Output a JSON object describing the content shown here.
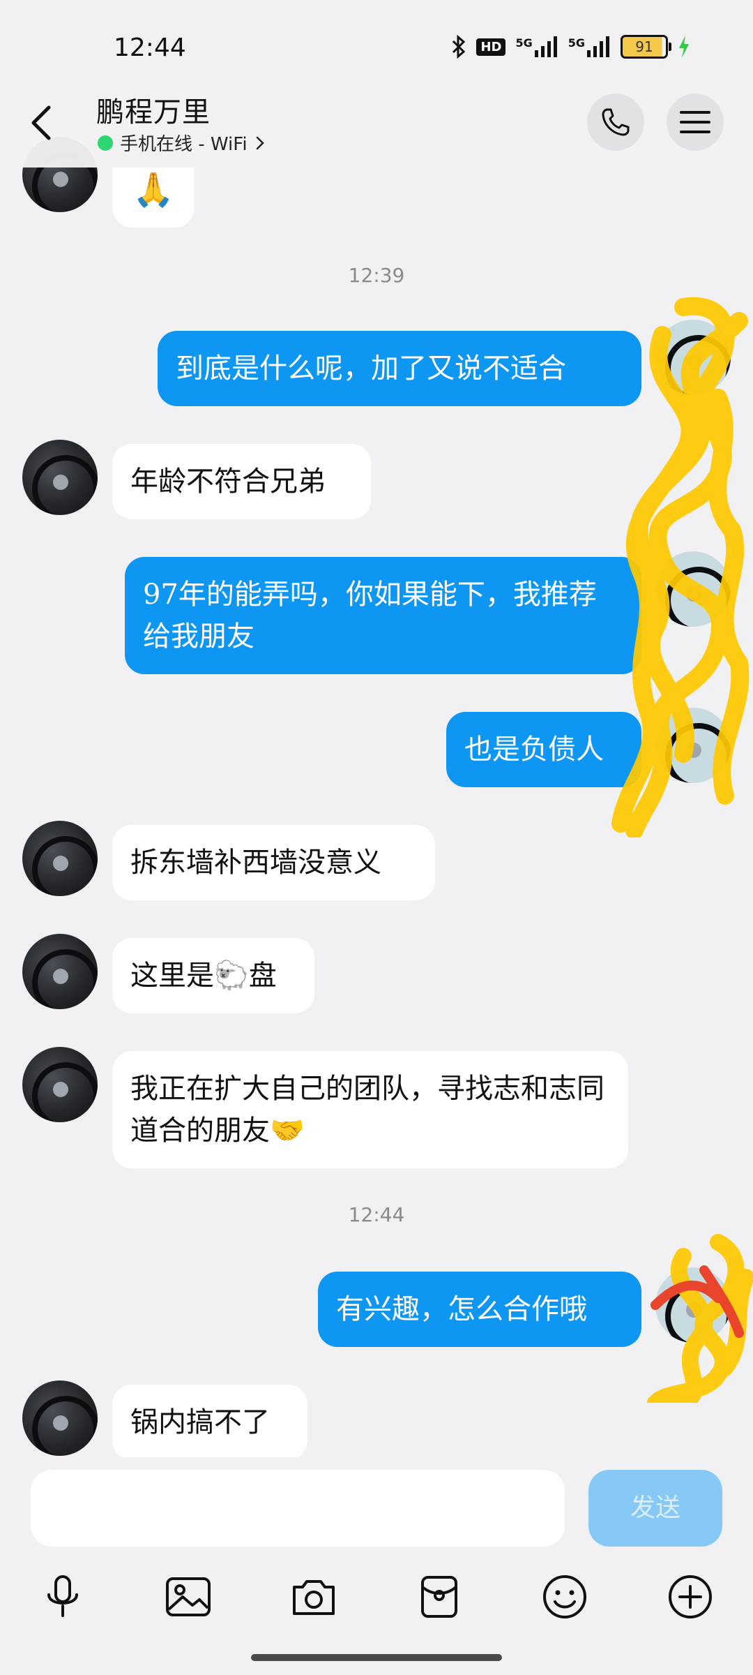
{
  "status_bar": {
    "time": "12:44",
    "hd_label": "HD",
    "signal1_label": "5G",
    "signal2_label": "5G",
    "battery": "91"
  },
  "header": {
    "contact_name": "鹏程万里",
    "status_text": "手机在线 - WiFi",
    "status_color": "#2ed573"
  },
  "messages": [
    {
      "side": "in",
      "text": "🙏"
    },
    {
      "timestamp": "12:39"
    },
    {
      "side": "out",
      "text": "到底是什么呢，加了又说不适合"
    },
    {
      "side": "in",
      "text": "年龄不符合兄弟"
    },
    {
      "side": "out",
      "text": "97年的能弄吗，你如果能下，我推荐给我朋友"
    },
    {
      "side": "out",
      "text": "也是负债人"
    },
    {
      "side": "in",
      "text": "拆东墙补西墙没意义"
    },
    {
      "side": "in",
      "text": "这里是🐑盘"
    },
    {
      "side": "in",
      "text": "我正在扩大自己的团队，寻找志和志同道合的朋友🤝"
    },
    {
      "timestamp": "12:44"
    },
    {
      "side": "out",
      "text": "有兴趣，怎么合作哦"
    },
    {
      "side": "in",
      "text": "锅内搞不了"
    }
  ],
  "composer": {
    "input_value": "",
    "send_label": "发送"
  },
  "toolbar_icons": [
    "microphone-icon",
    "image-icon",
    "camera-icon",
    "red-packet-icon",
    "emoji-icon",
    "plus-icon"
  ],
  "colors": {
    "outgoing_bubble": "#0d96f2",
    "incoming_bubble": "#ffffff",
    "background": "#f1f1f3",
    "send_button": "#86c8f6",
    "scribble": "#ffc900"
  }
}
